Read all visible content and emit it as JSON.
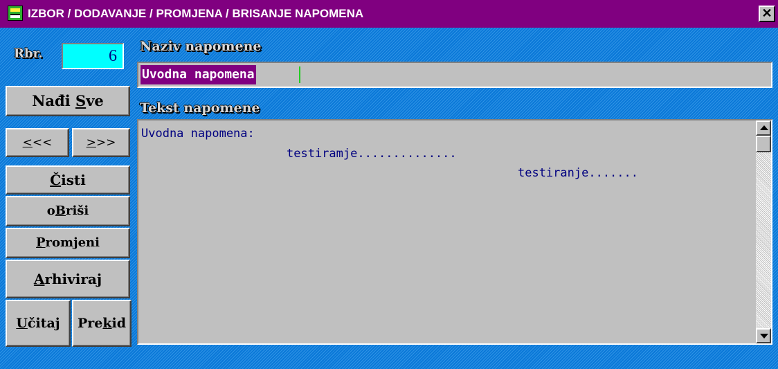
{
  "window": {
    "title": "IZBOR / DODAVANJE / PROMJENA / BRISANJE  NAPOMENA",
    "close_glyph": "✕"
  },
  "rbr": {
    "label": "Rbr.",
    "value": "6"
  },
  "buttons": {
    "nadi_sve": {
      "pre": "Nađi ",
      "key": "S",
      "post": "ve"
    },
    "prev": {
      "key": "<",
      "post": "<<"
    },
    "next": {
      "key": ">",
      "post": ">>"
    },
    "cisti": {
      "pre": "",
      "key": "Č",
      "post": "isti"
    },
    "obrisi": {
      "pre": "o",
      "key": "B",
      "post": "riši"
    },
    "promjeni": {
      "pre": "",
      "key": "P",
      "post": "romjeni"
    },
    "arhiviraj": {
      "pre": "",
      "key": "A",
      "post": "rhiviraj"
    },
    "ucitaj": {
      "pre": "",
      "key": "U",
      "post": "čitaj"
    },
    "prekid": {
      "pre": "Pre",
      "key": "k",
      "post": "id"
    }
  },
  "naziv": {
    "label": "Naziv napomene",
    "value": "Uvodna napomena"
  },
  "tekst": {
    "label": "Tekst napomene",
    "lines": [
      "Uvodna napomena:",
      "testiramje..............",
      "testiranje......."
    ]
  },
  "colors": {
    "title_bar": "#800080",
    "background": "#0a78d8",
    "control_face": "#c0c0c0",
    "rbr_field": "#00ffff",
    "text_blue": "#000080"
  },
  "icons": {
    "app": "app-icon",
    "close": "close-icon",
    "scroll_up": "arrow-up-icon",
    "scroll_down": "arrow-down-icon"
  }
}
